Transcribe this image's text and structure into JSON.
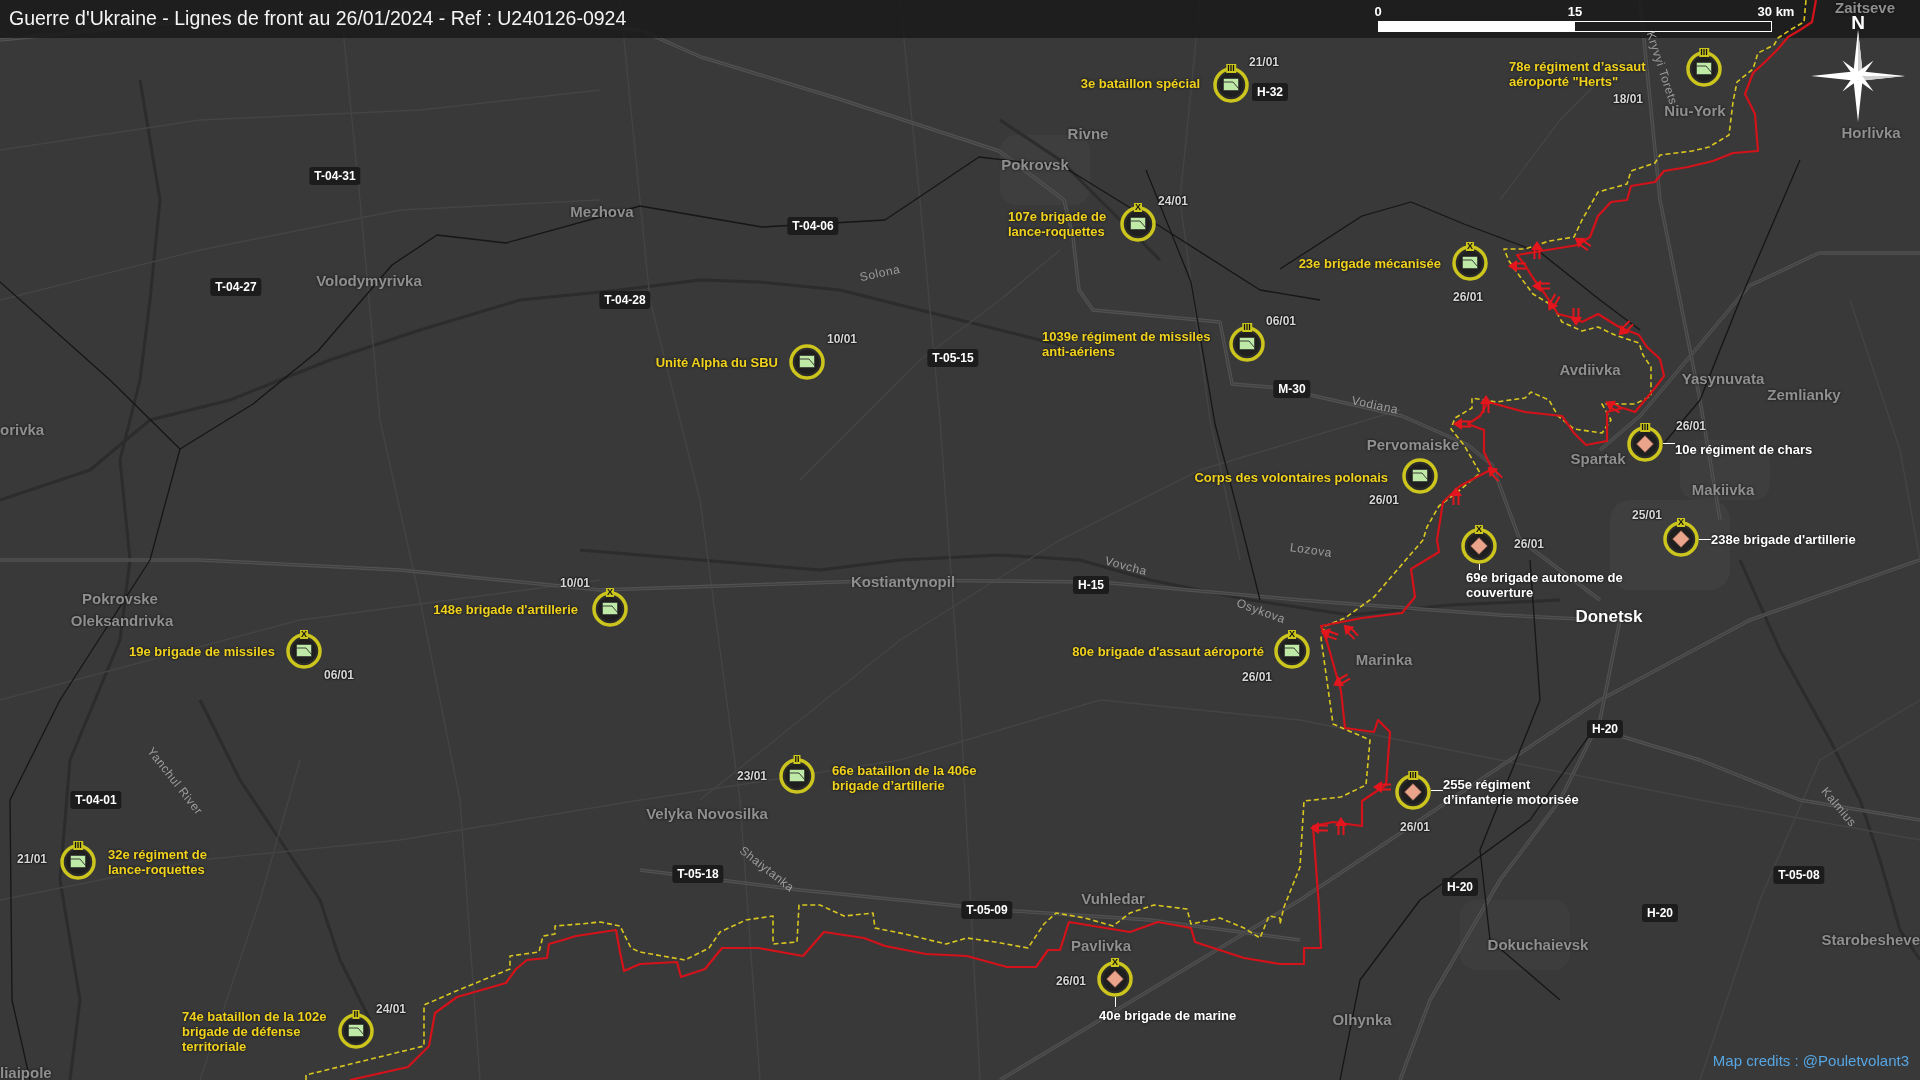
{
  "header": {
    "title": "Guerre d'Ukraine - Lignes de front au 26/01/2024 - Ref : U240126-0924",
    "scale_labels": [
      "0",
      "15",
      "30 km"
    ],
    "compass_label": "N"
  },
  "places": [
    {
      "name": "Zaitseve",
      "kind": "town"
    },
    {
      "name": "Niu-York",
      "kind": "town"
    },
    {
      "name": "Rivne",
      "kind": "town"
    },
    {
      "name": "Horlivka",
      "kind": "town"
    },
    {
      "name": "Pokrovsk",
      "kind": "town"
    },
    {
      "name": "Mezhova",
      "kind": "town"
    },
    {
      "name": "Volodymyrivka",
      "kind": "town"
    },
    {
      "name": "Avdiivka",
      "kind": "town"
    },
    {
      "name": "Yasynuvata",
      "kind": "town"
    },
    {
      "name": "Zemlianky",
      "kind": "town"
    },
    {
      "name": "orivka",
      "kind": "town"
    },
    {
      "name": "Pervomaiske",
      "kind": "town"
    },
    {
      "name": "Spartak",
      "kind": "town"
    },
    {
      "name": "Makiivka",
      "kind": "town"
    },
    {
      "name": "Kostiantynopil",
      "kind": "town"
    },
    {
      "name": "Pokrovske",
      "kind": "town"
    },
    {
      "name": "Oleksandrivka",
      "kind": "town"
    },
    {
      "name": "Donetsk",
      "kind": "city"
    },
    {
      "name": "Marinka",
      "kind": "town"
    },
    {
      "name": "Velyka Novosilka",
      "kind": "town"
    },
    {
      "name": "Vuhledar",
      "kind": "town"
    },
    {
      "name": "Pavlivka",
      "kind": "town"
    },
    {
      "name": "Dokuchaievsk",
      "kind": "town"
    },
    {
      "name": "Starobesheve",
      "kind": "town"
    },
    {
      "name": "Olhynka",
      "kind": "town"
    },
    {
      "name": "liaipole",
      "kind": "town"
    }
  ],
  "rivers": [
    "Kryvyi Torets",
    "Solona",
    "Vodiana",
    "Vovcha",
    "Lozova",
    "Osykova",
    "Yanchul River",
    "Kalmius",
    "Shaiytanka"
  ],
  "roads": [
    "H-32",
    "T-04-31",
    "T-04-06",
    "T-04-27",
    "T-04-28",
    "T-05-15",
    "M-30",
    "H-15",
    "H-20",
    "T-04-01",
    "T-05-18",
    "H-20",
    "T-05-08",
    "T-05-09",
    "H-20"
  ],
  "units": [
    {
      "label": "3e bataillon spécial",
      "date": "21/01",
      "echelon": "III",
      "kind": "square"
    },
    {
      "label": "78e régiment d’assaut\naéroporté \"Herts\"",
      "date": "18/01",
      "echelon": "III",
      "kind": "square"
    },
    {
      "label": "107e brigade de\nlance-roquettes",
      "date": "24/01",
      "echelon": "X",
      "kind": "square"
    },
    {
      "label": "23e brigade mécanisée",
      "date": "26/01",
      "echelon": "X",
      "kind": "square"
    },
    {
      "label": "Unité Alpha du SBU",
      "date": "10/01",
      "kind": "square"
    },
    {
      "label": "1039e régiment de missiles\nanti-aériens",
      "date": "06/01",
      "echelon": "III",
      "kind": "square"
    },
    {
      "label": "10e régiment de chars",
      "date": "26/01",
      "echelon": "III",
      "kind": "diamond"
    },
    {
      "label": "Corps des volontaires polonais",
      "date": "26/01",
      "kind": "square"
    },
    {
      "label": "69e brigade autonome de\ncouverture",
      "date": "26/01",
      "echelon": "X",
      "kind": "diamond"
    },
    {
      "label": "238e brigade d'artillerie",
      "date": "25/01",
      "echelon": "X",
      "kind": "diamond"
    },
    {
      "label": "148e brigade d'artillerie",
      "date": "10/01",
      "echelon": "X",
      "kind": "square"
    },
    {
      "label": "19e brigade de missiles",
      "date": "06/01",
      "echelon": "X",
      "kind": "square"
    },
    {
      "label": "80e brigade d'assaut aéroporté",
      "date": "26/01",
      "echelon": "X",
      "kind": "square"
    },
    {
      "label": "66e bataillon de la 406e\nbrigade d’artillerie",
      "date": "23/01",
      "echelon": "II",
      "kind": "square"
    },
    {
      "label": "255e régiment\nd’infanterie motorisée",
      "date": "26/01",
      "echelon": "III",
      "kind": "diamond"
    },
    {
      "label": "32e régiment de\nlance-roquettes",
      "date": "21/01",
      "echelon": "III",
      "kind": "square"
    },
    {
      "label": "74e bataillon de la 102e\nbrigade de défense\nterritoriale",
      "date": "24/01",
      "echelon": "II",
      "kind": "square"
    },
    {
      "label": "40e brigade de marine",
      "date": "26/01",
      "echelon": "X",
      "kind": "diamond"
    }
  ],
  "credits": "Map credits : @Pouletvolant3"
}
